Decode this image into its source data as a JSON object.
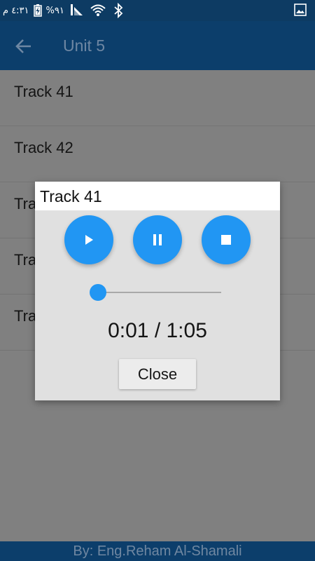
{
  "status_bar": {
    "time": "٤:٣١ م",
    "battery": "%٩١",
    "icons": [
      "battery-charging-icon",
      "signal-icon",
      "wifi-icon",
      "bluetooth-icon",
      "gallery-icon"
    ]
  },
  "app_bar": {
    "title": "Unit 5",
    "back_icon": "arrow-left-icon"
  },
  "list": {
    "items": [
      {
        "label": "Track 41"
      },
      {
        "label": "Track 42"
      },
      {
        "label": "Tra"
      },
      {
        "label": "Tra"
      },
      {
        "label": "Tra"
      }
    ]
  },
  "dialog": {
    "title": "Track 41",
    "controls": [
      "play-icon",
      "pause-icon",
      "stop-icon"
    ],
    "progress": 0.015,
    "time_display": "0:01 / 1:05",
    "close_label": "Close"
  },
  "footer": {
    "credit": "By: Eng.Reham Al-Shamali"
  },
  "colors": {
    "status_bar": "#0d3b63",
    "app_bar": "#0c3e6b",
    "accent": "#2196f3",
    "overlay_bg": "#808080",
    "dialog_bg": "#e0e0e0"
  }
}
